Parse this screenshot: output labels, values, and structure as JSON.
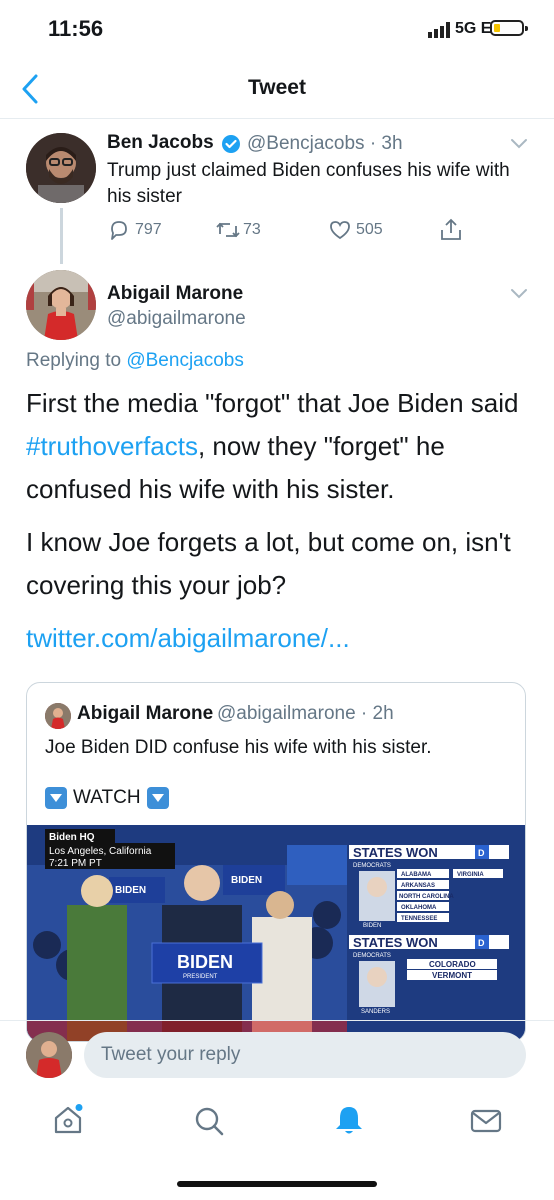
{
  "status": {
    "time": "11:56",
    "network": "5G E"
  },
  "header": {
    "title": "Tweet"
  },
  "parent_tweet": {
    "name": "Ben Jacobs",
    "handle": "@Bencjacobs",
    "time": "· 3h",
    "text": "Trump just claimed Biden confuses his wife with his sister",
    "replies": "797",
    "retweets": "73",
    "likes": "505"
  },
  "main_tweet": {
    "name": "Abigail Marone",
    "handle": "@abigailmarone",
    "replying_prefix": "Replying to",
    "replying_to": "@Bencjacobs",
    "text_1a": "First the media \"forgot\" that Joe Biden said ",
    "hashtag": "#truthoverfacts",
    "text_1b": ", now they \"forget\" he confused his wife with his sister.",
    "text_2": "I know Joe forgets a lot, but come on, isn't covering this your job?",
    "link": "twitter.com/abigailmarone/..."
  },
  "quoted_tweet": {
    "name": "Abigail Marone",
    "handle": "@abigailmarone",
    "time": "· 2h",
    "text": "Joe Biden DID confuse his wife with his sister.",
    "watch_label": "WATCH"
  },
  "media": {
    "location_title": "Biden HQ",
    "location": "Los Angeles, California",
    "time": "7:21 PM PT",
    "podium_main": "BIDEN",
    "podium_sub": "PRESIDENT",
    "sign_text": "BIDEN",
    "states_won_1": "STATES WON",
    "democrats_1": "DEMOCRATS",
    "states_list_1": [
      "ALABAMA",
      "ARKANSAS",
      "NORTH CAROLINA",
      "OKLAHOMA",
      "TENNESSEE"
    ],
    "states_extra_1": "VIRGINIA",
    "candidate_1": "BIDEN",
    "states_won_2": "STATES WON",
    "democrats_2": "DEMOCRATS",
    "states_list_2": [
      "COLORADO",
      "VERMONT"
    ],
    "candidate_2": "SANDERS",
    "badge": "D"
  },
  "compose": {
    "placeholder": "Tweet your reply"
  },
  "colors": {
    "accent": "#1da1f2",
    "secondary_text": "#657786",
    "divider": "#e6ecf0"
  },
  "icons": [
    "chevron-left-icon",
    "verified-icon",
    "reply-icon",
    "retweet-icon",
    "like-icon",
    "share-icon",
    "home-icon",
    "search-icon",
    "notifications-icon",
    "messages-icon"
  ]
}
